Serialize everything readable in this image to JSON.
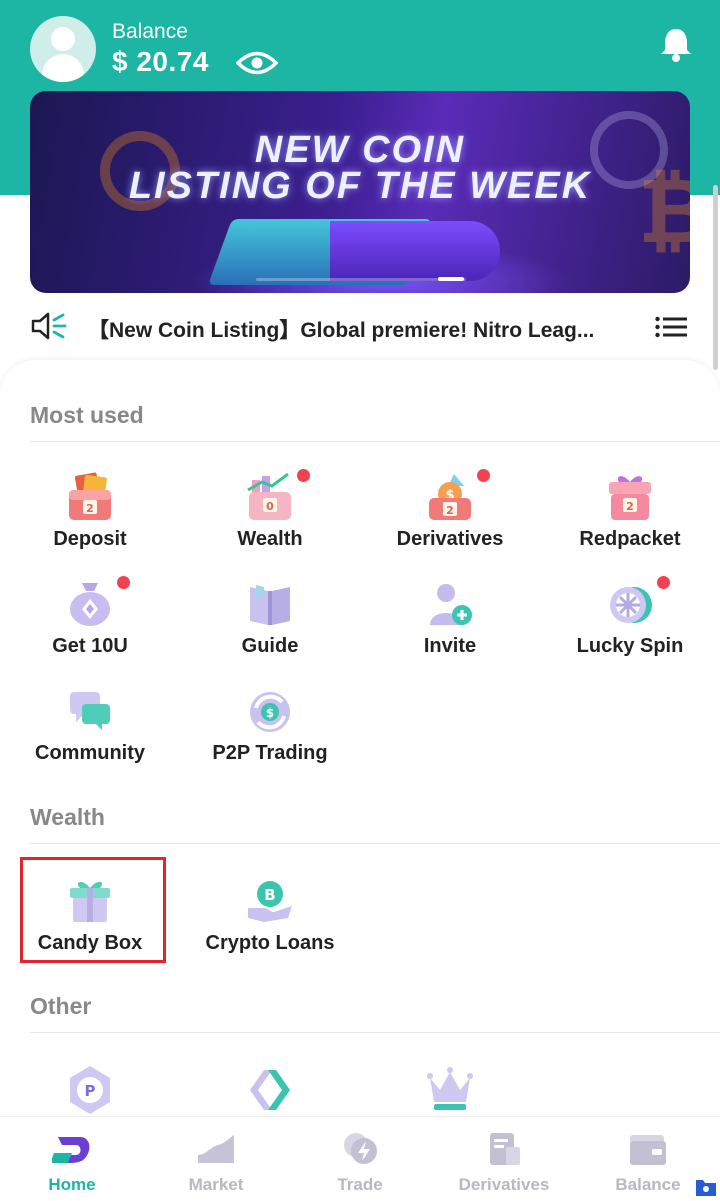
{
  "header": {
    "balance_label": "Balance",
    "balance_value": "$ 20.74",
    "avatar_icon": "user-avatar-icon",
    "eye_icon": "eye-icon",
    "bell_icon": "bell-icon",
    "accent_color": "#1db5a3"
  },
  "banner": {
    "line1": "NEW COIN",
    "line2": "LISTING OF THE WEEK",
    "slides": 2,
    "active_slide": 2
  },
  "notice": {
    "text": "【New Coin Listing】Global premiere! Nitro Leag...",
    "speaker_icon": "speaker-icon",
    "menu_icon": "list-menu-icon"
  },
  "sections": {
    "most_used": {
      "title": "Most used",
      "items": [
        {
          "label": "Deposit",
          "icon": "deposit-icon",
          "badge": false
        },
        {
          "label": "Wealth",
          "icon": "wealth-icon",
          "badge": true
        },
        {
          "label": "Derivatives",
          "icon": "derivatives-icon",
          "badge": true
        },
        {
          "label": "Redpacket",
          "icon": "redpacket-icon",
          "badge": false
        },
        {
          "label": "Get 10U",
          "icon": "money-bag-icon",
          "badge": true
        },
        {
          "label": "Guide",
          "icon": "book-icon",
          "badge": false
        },
        {
          "label": "Invite",
          "icon": "invite-user-icon",
          "badge": false
        },
        {
          "label": "Lucky Spin",
          "icon": "spin-wheel-icon",
          "badge": true
        },
        {
          "label": "Community",
          "icon": "chat-bubbles-icon",
          "badge": false
        },
        {
          "label": "P2P Trading",
          "icon": "p2p-exchange-icon",
          "badge": false
        }
      ]
    },
    "wealth": {
      "title": "Wealth",
      "items": [
        {
          "label": "Candy Box",
          "icon": "gift-box-icon"
        },
        {
          "label": "Crypto Loans",
          "icon": "crypto-loan-icon"
        }
      ]
    },
    "other": {
      "title": "Other",
      "items": [
        {
          "icon": "token-hex-icon"
        },
        {
          "icon": "diamond-arrows-icon"
        },
        {
          "icon": "crown-icon"
        }
      ]
    }
  },
  "bottom_nav": {
    "items": [
      {
        "label": "Home",
        "icon": "home-logo-icon",
        "active": true
      },
      {
        "label": "Market",
        "icon": "market-chart-icon",
        "active": false
      },
      {
        "label": "Trade",
        "icon": "trade-bolt-icon",
        "active": false
      },
      {
        "label": "Derivatives",
        "icon": "derivatives-doc-icon",
        "active": false
      },
      {
        "label": "Balance",
        "icon": "wallet-icon",
        "active": false
      }
    ]
  }
}
